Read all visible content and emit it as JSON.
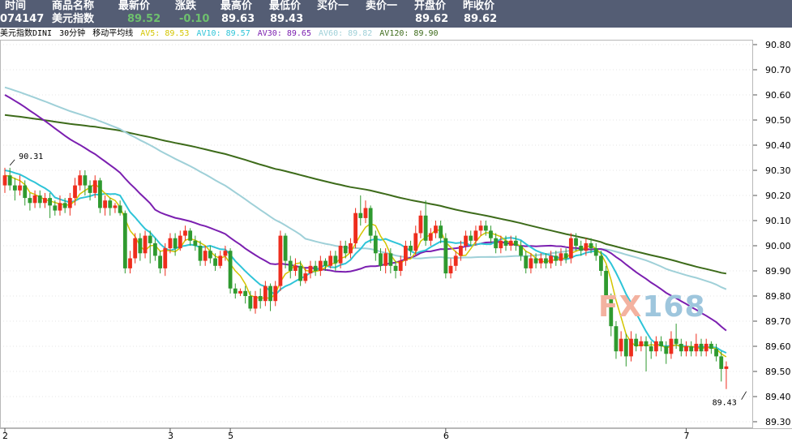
{
  "quote": {
    "headers": [
      "时间",
      "商品名称",
      "最新价",
      "涨跌",
      "最高价",
      "最低价",
      "买价一",
      "卖价一",
      "开盘价",
      "昨收价"
    ],
    "values": [
      "074147",
      "美元指数",
      "89.52",
      "-0.10",
      "89.63",
      "89.43",
      "",
      "",
      "89.62",
      "89.62"
    ],
    "value_colors": [
      "#ffffff",
      "#ffffff",
      "#6ec06e",
      "#6ec06e",
      "#ffffff",
      "#ffffff",
      "#ffffff",
      "#ffffff",
      "#ffffff",
      "#ffffff"
    ]
  },
  "info": {
    "symbol": "美元指数DINI",
    "period": "30分钟",
    "indicator": "移动平均线",
    "ma": [
      {
        "label": "AV5: 89.53",
        "color": "#d4c500"
      },
      {
        "label": "AV10: 89.57",
        "color": "#2ec4d8"
      },
      {
        "label": "AV30: 89.65",
        "color": "#7b1fb0"
      },
      {
        "label": "AV60: 89.82",
        "color": "#9fd0d8"
      },
      {
        "label": "AV120: 89.90",
        "color": "#3d6b1a"
      }
    ]
  },
  "watermark": {
    "fx": "FX",
    "num": "168"
  },
  "colors": {
    "up": "#ee2d1d",
    "down": "#2f9a2f",
    "grid": "#cccccc"
  },
  "chart_data": {
    "type": "candlestick",
    "title": "",
    "xlabel": "",
    "ylabel": "",
    "ylim": [
      89.3,
      90.8
    ],
    "y_ticks": [
      "90.80",
      "90.70",
      "90.60",
      "90.50",
      "90.40",
      "90.30",
      "90.20",
      "90.10",
      "90.00",
      "89.90",
      "89.80",
      "89.70",
      "89.60",
      "89.50",
      "89.40",
      "89.30"
    ],
    "x_ticks": [
      {
        "label": "2",
        "index": 0
      },
      {
        "label": "3",
        "index": 33
      },
      {
        "label": "5",
        "index": 45
      },
      {
        "label": "6",
        "index": 88
      },
      {
        "label": "7",
        "index": 136
      }
    ],
    "annotations": [
      {
        "text": "90.31",
        "index": 1,
        "value": 90.31
      },
      {
        "text": "89.43",
        "index": 148,
        "value": 89.43
      }
    ],
    "candles": [
      [
        90.24,
        90.28,
        90.21,
        90.31
      ],
      [
        90.28,
        90.24,
        90.22,
        90.31
      ],
      [
        90.24,
        90.22,
        90.18,
        90.27
      ],
      [
        90.22,
        90.24,
        90.2,
        90.28
      ],
      [
        90.24,
        90.19,
        90.16,
        90.26
      ],
      [
        90.19,
        90.17,
        90.14,
        90.21
      ],
      [
        90.17,
        90.2,
        90.15,
        90.22
      ],
      [
        90.2,
        90.17,
        90.15,
        90.22
      ],
      [
        90.17,
        90.19,
        90.15,
        90.21
      ],
      [
        90.19,
        90.16,
        90.11,
        90.21
      ],
      [
        90.16,
        90.14,
        90.12,
        90.18
      ],
      [
        90.14,
        90.17,
        90.12,
        90.2
      ],
      [
        90.17,
        90.15,
        90.13,
        90.19
      ],
      [
        90.15,
        90.19,
        90.12,
        90.21
      ],
      [
        90.19,
        90.24,
        90.16,
        90.27
      ],
      [
        90.24,
        90.28,
        90.22,
        90.3
      ],
      [
        90.28,
        90.24,
        90.2,
        90.3
      ],
      [
        90.24,
        90.21,
        90.18,
        90.26
      ],
      [
        90.21,
        90.26,
        90.19,
        90.28
      ],
      [
        90.26,
        90.15,
        90.13,
        90.27
      ],
      [
        90.15,
        90.18,
        90.12,
        90.2
      ],
      [
        90.18,
        90.15,
        90.12,
        90.19
      ],
      [
        90.15,
        90.16,
        90.13,
        90.17
      ],
      [
        90.16,
        90.13,
        90.12,
        90.18
      ],
      [
        90.13,
        89.91,
        89.89,
        90.14
      ],
      [
        89.91,
        89.95,
        89.89,
        89.98
      ],
      [
        89.95,
        90.03,
        89.93,
        90.05
      ],
      [
        90.03,
        89.97,
        89.94,
        90.05
      ],
      [
        89.97,
        90.04,
        89.95,
        90.06
      ],
      [
        90.04,
        90.01,
        89.93,
        90.06
      ],
      [
        90.01,
        89.96,
        89.94,
        90.03
      ],
      [
        89.96,
        89.91,
        89.89,
        89.98
      ],
      [
        89.91,
        89.99,
        89.88,
        90.01
      ],
      [
        89.99,
        90.03,
        89.97,
        90.05
      ],
      [
        90.03,
        89.99,
        89.96,
        90.05
      ],
      [
        89.99,
        90.04,
        89.98,
        90.06
      ],
      [
        90.04,
        90.06,
        90.02,
        90.08
      ],
      [
        90.06,
        90.02,
        90.0,
        90.07
      ],
      [
        90.02,
        90.0,
        89.98,
        90.04
      ],
      [
        90.0,
        89.94,
        89.92,
        90.02
      ],
      [
        89.94,
        89.98,
        89.92,
        90.0
      ],
      [
        89.98,
        89.95,
        89.93,
        90.0
      ],
      [
        89.95,
        89.92,
        89.9,
        89.97
      ],
      [
        89.92,
        89.96,
        89.91,
        89.98
      ],
      [
        89.96,
        89.98,
        89.94,
        90.0
      ],
      [
        89.98,
        89.83,
        89.81,
        89.99
      ],
      [
        89.83,
        89.81,
        89.79,
        89.85
      ],
      [
        89.81,
        89.82,
        89.8,
        89.83
      ],
      [
        89.82,
        89.8,
        89.77,
        89.84
      ],
      [
        89.8,
        89.75,
        89.74,
        89.82
      ],
      [
        89.75,
        89.8,
        89.73,
        89.82
      ],
      [
        89.8,
        89.78,
        89.75,
        89.83
      ],
      [
        89.78,
        89.84,
        89.76,
        89.86
      ],
      [
        89.84,
        89.78,
        89.74,
        89.85
      ],
      [
        89.78,
        89.84,
        89.76,
        89.86
      ],
      [
        89.84,
        90.04,
        89.82,
        90.06
      ],
      [
        90.04,
        89.94,
        89.91,
        90.05
      ],
      [
        89.94,
        89.9,
        89.87,
        89.96
      ],
      [
        89.9,
        89.92,
        89.88,
        89.95
      ],
      [
        89.92,
        89.86,
        89.84,
        89.94
      ],
      [
        89.86,
        89.89,
        89.85,
        89.91
      ],
      [
        89.89,
        89.92,
        89.87,
        89.94
      ],
      [
        89.92,
        89.9,
        89.88,
        89.94
      ],
      [
        89.9,
        89.94,
        89.88,
        89.96
      ],
      [
        89.94,
        89.92,
        89.9,
        89.95
      ],
      [
        89.92,
        89.96,
        89.91,
        89.98
      ],
      [
        89.96,
        89.93,
        89.9,
        89.98
      ],
      [
        89.93,
        90.0,
        89.91,
        90.02
      ],
      [
        90.0,
        89.97,
        89.95,
        90.02
      ],
      [
        89.97,
        90.01,
        89.95,
        90.03
      ],
      [
        90.01,
        90.13,
        89.99,
        90.15
      ],
      [
        90.13,
        90.11,
        90.08,
        90.2
      ],
      [
        90.11,
        90.15,
        90.09,
        90.18
      ],
      [
        90.15,
        90.04,
        90.01,
        90.16
      ],
      [
        90.04,
        89.97,
        89.94,
        90.06
      ],
      [
        89.97,
        89.92,
        89.9,
        89.99
      ],
      [
        89.92,
        89.97,
        89.89,
        89.99
      ],
      [
        89.97,
        89.92,
        89.89,
        89.99
      ],
      [
        89.92,
        89.9,
        89.87,
        89.94
      ],
      [
        89.9,
        89.94,
        89.88,
        89.96
      ],
      [
        89.94,
        90.0,
        89.92,
        90.02
      ],
      [
        90.0,
        89.98,
        89.96,
        90.02
      ],
      [
        89.98,
        90.05,
        89.96,
        90.08
      ],
      [
        90.05,
        90.12,
        90.03,
        90.14
      ],
      [
        90.12,
        90.02,
        90.0,
        90.18
      ],
      [
        90.02,
        90.05,
        90.0,
        90.07
      ],
      [
        90.05,
        90.08,
        90.03,
        90.1
      ],
      [
        90.08,
        90.03,
        90.01,
        90.1
      ],
      [
        90.03,
        89.89,
        89.87,
        90.05
      ],
      [
        89.89,
        89.92,
        89.87,
        89.95
      ],
      [
        89.92,
        89.96,
        89.9,
        89.98
      ],
      [
        89.96,
        90.0,
        89.94,
        90.02
      ],
      [
        90.0,
        90.04,
        89.98,
        90.06
      ],
      [
        90.04,
        90.02,
        90.0,
        90.06
      ],
      [
        90.02,
        90.06,
        90.0,
        90.08
      ],
      [
        90.06,
        90.08,
        90.04,
        90.1
      ],
      [
        90.08,
        90.06,
        90.04,
        90.1
      ],
      [
        90.06,
        90.03,
        90.01,
        90.08
      ],
      [
        90.03,
        89.99,
        89.97,
        90.05
      ],
      [
        89.99,
        90.02,
        89.97,
        90.04
      ],
      [
        90.02,
        90.0,
        89.98,
        90.04
      ],
      [
        90.0,
        90.02,
        89.98,
        90.04
      ],
      [
        90.02,
        90.0,
        89.98,
        90.04
      ],
      [
        90.0,
        89.96,
        89.94,
        90.02
      ],
      [
        89.96,
        89.91,
        89.89,
        89.98
      ],
      [
        89.91,
        89.95,
        89.89,
        89.97
      ],
      [
        89.95,
        89.93,
        89.91,
        89.97
      ],
      [
        89.93,
        89.95,
        89.91,
        89.97
      ],
      [
        89.95,
        89.93,
        89.91,
        89.97
      ],
      [
        89.93,
        89.96,
        89.91,
        89.98
      ],
      [
        89.96,
        89.94,
        89.92,
        89.98
      ],
      [
        89.94,
        89.97,
        89.92,
        89.99
      ],
      [
        89.97,
        89.95,
        89.93,
        89.99
      ],
      [
        89.95,
        90.03,
        89.93,
        90.05
      ],
      [
        90.03,
        90.0,
        89.98,
        90.05
      ],
      [
        90.0,
        89.98,
        89.96,
        90.02
      ],
      [
        89.98,
        90.01,
        89.96,
        90.03
      ],
      [
        90.01,
        89.99,
        89.97,
        90.03
      ],
      [
        89.99,
        89.96,
        89.94,
        90.01
      ],
      [
        89.96,
        89.9,
        89.88,
        89.98
      ],
      [
        89.9,
        89.79,
        89.77,
        89.92
      ],
      [
        89.79,
        89.68,
        89.64,
        89.81
      ],
      [
        89.68,
        89.58,
        89.55,
        89.7
      ],
      [
        89.58,
        89.63,
        89.56,
        89.66
      ],
      [
        89.63,
        89.56,
        89.52,
        89.65
      ],
      [
        89.56,
        89.63,
        89.54,
        89.66
      ],
      [
        89.63,
        89.6,
        89.58,
        89.65
      ],
      [
        89.6,
        89.62,
        89.58,
        89.64
      ],
      [
        89.62,
        89.6,
        89.5,
        89.64
      ],
      [
        89.6,
        89.58,
        89.55,
        89.62
      ],
      [
        89.58,
        89.62,
        89.56,
        89.64
      ],
      [
        89.62,
        89.6,
        89.58,
        89.64
      ],
      [
        89.6,
        89.57,
        89.53,
        89.62
      ],
      [
        89.57,
        89.63,
        89.55,
        89.66
      ],
      [
        89.63,
        89.61,
        89.59,
        89.69
      ],
      [
        89.61,
        89.58,
        89.56,
        89.63
      ],
      [
        89.58,
        89.6,
        89.56,
        89.62
      ],
      [
        89.6,
        89.58,
        89.56,
        89.62
      ],
      [
        89.58,
        89.61,
        89.56,
        89.65
      ],
      [
        89.61,
        89.58,
        89.56,
        89.63
      ],
      [
        89.58,
        89.61,
        89.56,
        89.63
      ],
      [
        89.61,
        89.59,
        89.57,
        89.62
      ],
      [
        89.59,
        89.56,
        89.54,
        89.61
      ],
      [
        89.56,
        89.51,
        89.46,
        89.58
      ],
      [
        89.51,
        89.52,
        89.43,
        89.54
      ]
    ]
  }
}
